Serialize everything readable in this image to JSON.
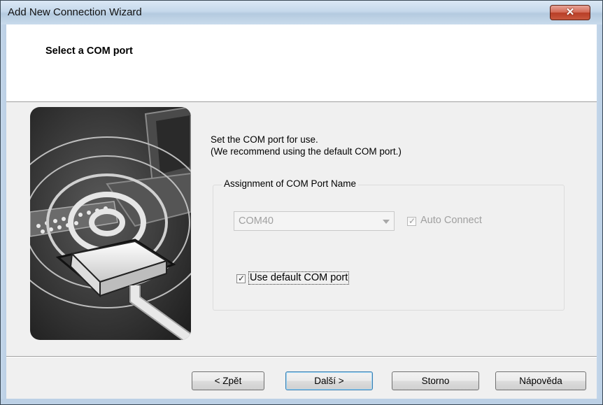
{
  "window": {
    "title": "Add New Connection Wizard",
    "close_glyph": "✕"
  },
  "header": {
    "title": "Select a COM port"
  },
  "content": {
    "instruction_line1": "Set the COM port for use.",
    "instruction_line2": "(We recommend using the default COM port.)",
    "group_title": "Assignment of COM Port Name",
    "com_port": {
      "value": "COM40",
      "enabled": false
    },
    "auto_connect": {
      "label": "Auto Connect",
      "checked": true,
      "enabled": false
    },
    "use_default": {
      "label": "Use default COM port",
      "checked": true
    },
    "check_glyph": "✓"
  },
  "footer": {
    "back_label": "< Zpět",
    "next_label": "Další >",
    "cancel_label": "Storno",
    "help_label": "Nápověda"
  },
  "icons": {
    "illustration": "serial-cable-radio-waves-illustration"
  }
}
